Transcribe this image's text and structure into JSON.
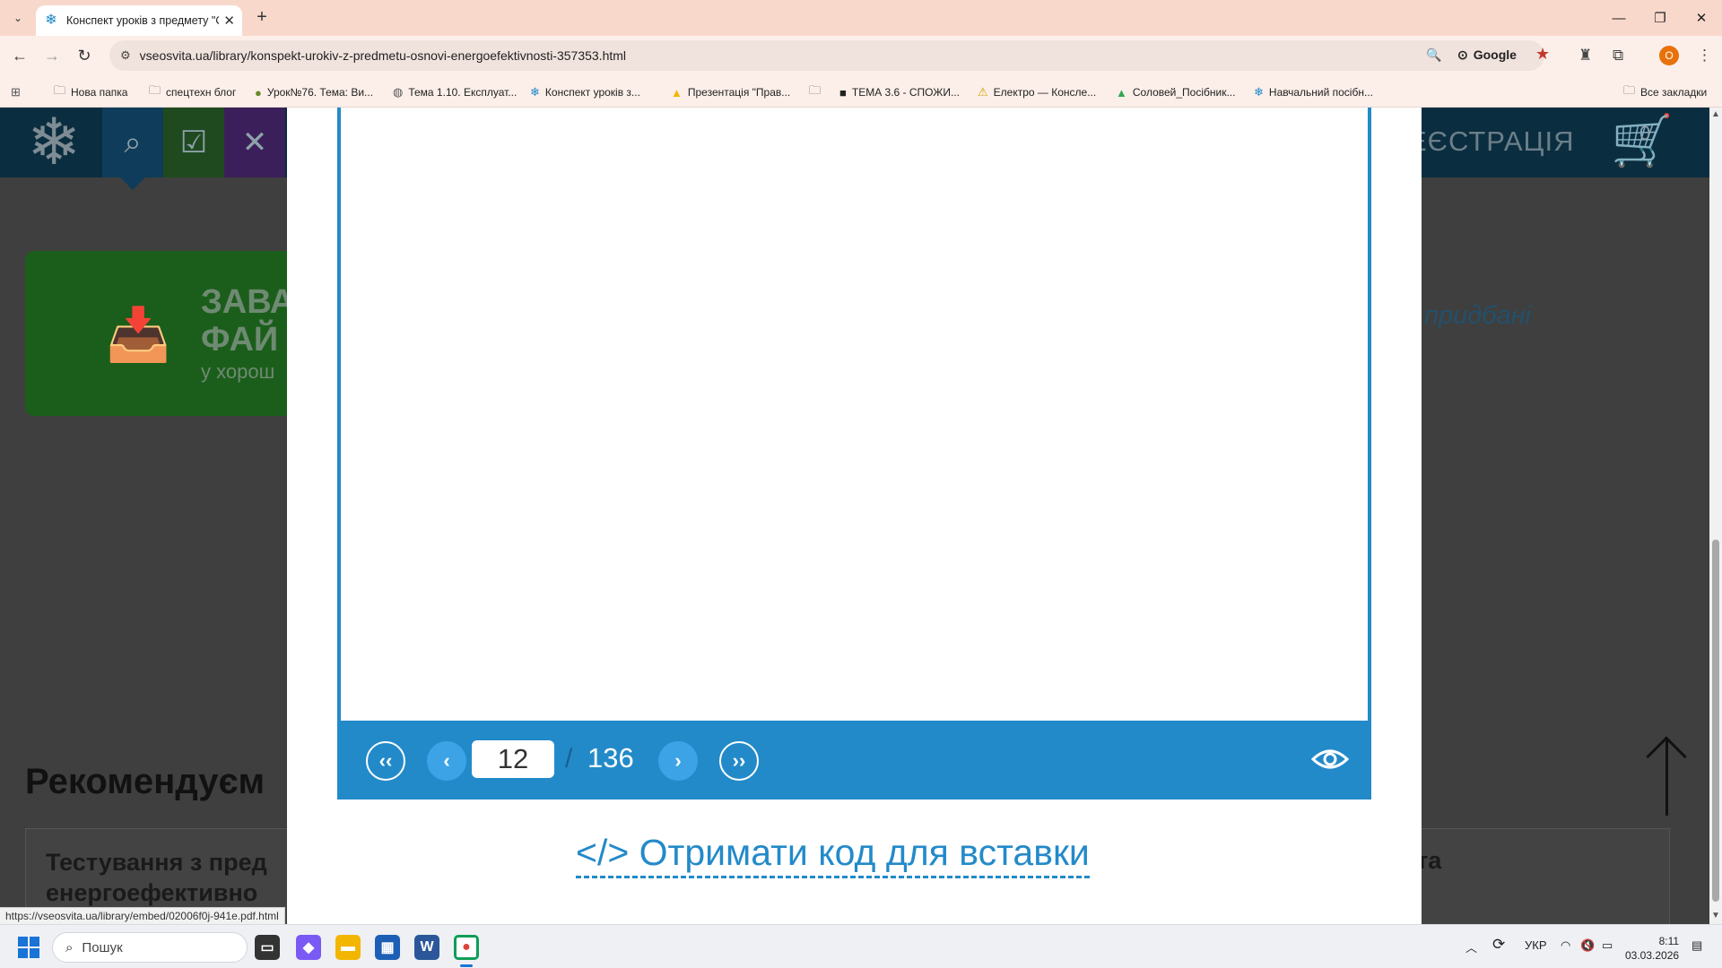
{
  "browser": {
    "tab_title": "Конспект уроків з предмету \"О",
    "url": "vseosvita.ua/library/konspekt-urokiv-z-predmetu-osnovi-energoefektivnosti-357353.html",
    "omnibox_search_engine": "Google",
    "profile_initial": "O",
    "bookmarks": [
      {
        "icon": "folder-icon",
        "label": "Нова папка"
      },
      {
        "icon": "folder-icon",
        "label": "спецтехн блог"
      },
      {
        "icon": "site-icon",
        "label": "Урок№76. Тема: Ви..."
      },
      {
        "icon": "globe-icon",
        "label": "Тема 1.10. Експлуат..."
      },
      {
        "icon": "snowflake-icon",
        "label": "Конспект уроків з..."
      },
      {
        "icon": "slides-icon",
        "label": "Презентація \"Прав..."
      },
      {
        "icon": "folder-icon",
        "label": ""
      },
      {
        "icon": "site-icon",
        "label": "ТЕМА 3.6 - СПОЖИ..."
      },
      {
        "icon": "warning-icon",
        "label": "Електро — Консле..."
      },
      {
        "icon": "drive-icon",
        "label": "Соловей_Посібник..."
      },
      {
        "icon": "snowflake-icon",
        "label": "Навчальний посібн..."
      }
    ],
    "all_bookmarks_label": "Все закладки",
    "status_url": "https://vseosvita.ua/library/embed/02006f0j-941e.pdf.html"
  },
  "page": {
    "header_right_text": "ЕЄСТРАЦІЯ",
    "cart_count": "0",
    "promo_line1": "ЗАВА",
    "promo_line2": "ФАЙ",
    "promo_sub": "у хорош",
    "bought_text": "придбані",
    "recommend_heading": "Рекомендуєм",
    "test_title": "Тестування з пред енергоефективно",
    "test_right": "та"
  },
  "viewer": {
    "current_page": "12",
    "separator": "/",
    "total_pages": "136",
    "embed_link": "</> Отримати код для вставки"
  },
  "taskbar": {
    "search_placeholder": "Пошук",
    "language": "УКР",
    "time": "8:11",
    "date": "03.03.2026"
  }
}
